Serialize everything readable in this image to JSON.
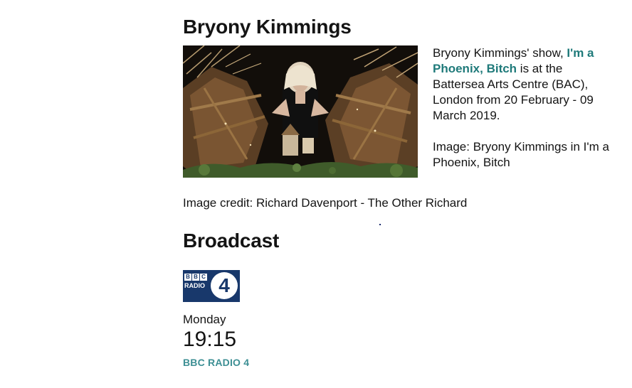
{
  "feature": {
    "heading": "Bryony Kimmings",
    "image_alt": "Bryony Kimmings in I'm a Phoenix, Bitch",
    "text_intro": "Bryony Kimmings' show, ",
    "show_link": "I'm a Phoenix, Bitch",
    "text_rest": " is at the Battersea Arts Centre (BAC), London from 20 February - 09 March 2019.",
    "image_caption": "Image: Bryony Kimmings in I'm a Phoenix, Bitch",
    "credit": "Image credit: Richard Davenport - The Other Richard"
  },
  "broadcast": {
    "heading": "Broadcast",
    "logo": {
      "letters": [
        "B",
        "B",
        "C"
      ],
      "radio": "RADIO",
      "number": "4"
    },
    "day": "Monday",
    "time": "19:15",
    "station": "BBC RADIO 4"
  },
  "colors": {
    "link": "#1f7a7a",
    "station": "#3d8f94",
    "logo_bg": "#18386b"
  }
}
